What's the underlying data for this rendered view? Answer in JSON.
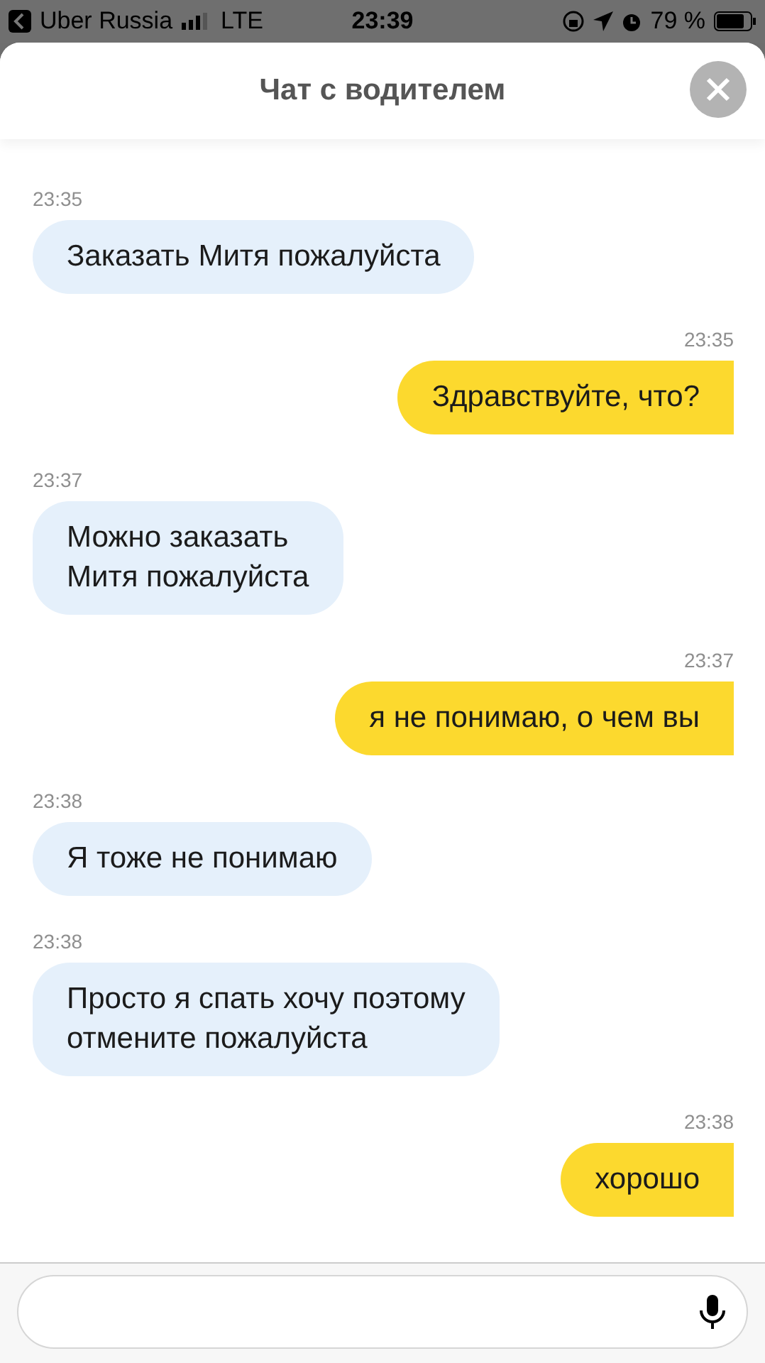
{
  "status_bar": {
    "back_label": "Uber Russia",
    "network": "LTE",
    "time": "23:39",
    "battery": "79 %"
  },
  "header": {
    "title": "Чат с водителем"
  },
  "messages": [
    {
      "time": "23:35",
      "text": "Заказать Митя пожалуйста",
      "outgoing": false
    },
    {
      "time": "23:35",
      "text": "Здравствуйте, что?",
      "outgoing": true
    },
    {
      "time": "23:37",
      "text": "Можно заказать\nМитя пожалуйста",
      "outgoing": false
    },
    {
      "time": "23:37",
      "text": "я не понимаю, о чем вы",
      "outgoing": true
    },
    {
      "time": "23:38",
      "text": "Я тоже не понимаю",
      "outgoing": false
    },
    {
      "time": "23:38",
      "text": "Просто я спать хочу поэтому\nотмените пожалуйста",
      "outgoing": false
    },
    {
      "time": "23:38",
      "text": "хорошо",
      "outgoing": true
    }
  ]
}
